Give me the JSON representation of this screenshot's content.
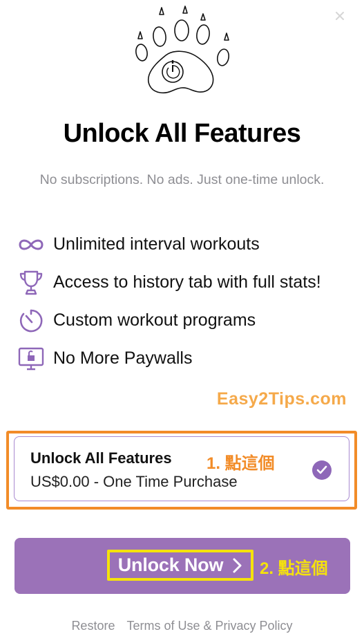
{
  "header": {
    "close_icon": "close-icon"
  },
  "logo": {
    "icon": "paw-stopwatch-icon"
  },
  "title": "Unlock All Features",
  "subtitle": "No subscriptions. No ads. Just one-time unlock.",
  "features": [
    {
      "icon": "infinity-icon",
      "label": "Unlimited interval workouts"
    },
    {
      "icon": "trophy-icon",
      "label": "Access to history tab with full stats!"
    },
    {
      "icon": "stopwatch-icon",
      "label": "Custom workout programs"
    },
    {
      "icon": "unlocked-monitor-icon",
      "label": "No More Paywalls"
    }
  ],
  "watermark": "Easy2Tips.com",
  "product": {
    "name": "Unlock All Features",
    "price": "US$0.00 - One Time Purchase",
    "selected": true
  },
  "annotations": {
    "step1": "1. 點這個",
    "step2": "2. 點這個"
  },
  "cta": {
    "label": "Unlock Now"
  },
  "footer": {
    "restore": "Restore",
    "terms": "Terms of Use & Privacy Policy"
  },
  "colors": {
    "accent": "#9b72b8",
    "icon": "#8e67b8",
    "annotation_orange": "#f28c28",
    "annotation_yellow": "#f5e20c",
    "muted_text": "#8e8e93"
  }
}
